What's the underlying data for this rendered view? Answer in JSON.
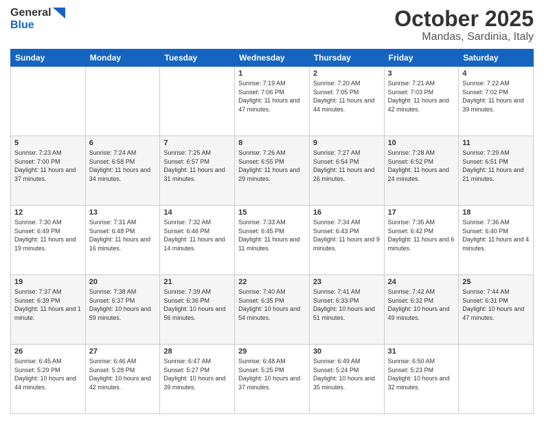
{
  "logo": {
    "line1": "General",
    "line2": "Blue"
  },
  "title": "October 2025",
  "location": "Mandas, Sardinia, Italy",
  "days_of_week": [
    "Sunday",
    "Monday",
    "Tuesday",
    "Wednesday",
    "Thursday",
    "Friday",
    "Saturday"
  ],
  "weeks": [
    [
      {
        "day": "",
        "text": ""
      },
      {
        "day": "",
        "text": ""
      },
      {
        "day": "",
        "text": ""
      },
      {
        "day": "1",
        "text": "Sunrise: 7:19 AM\nSunset: 7:06 PM\nDaylight: 11 hours and 47 minutes."
      },
      {
        "day": "2",
        "text": "Sunrise: 7:20 AM\nSunset: 7:05 PM\nDaylight: 11 hours and 44 minutes."
      },
      {
        "day": "3",
        "text": "Sunrise: 7:21 AM\nSunset: 7:03 PM\nDaylight: 11 hours and 42 minutes."
      },
      {
        "day": "4",
        "text": "Sunrise: 7:22 AM\nSunset: 7:02 PM\nDaylight: 11 hours and 39 minutes."
      }
    ],
    [
      {
        "day": "5",
        "text": "Sunrise: 7:23 AM\nSunset: 7:00 PM\nDaylight: 11 hours and 37 minutes."
      },
      {
        "day": "6",
        "text": "Sunrise: 7:24 AM\nSunset: 6:58 PM\nDaylight: 11 hours and 34 minutes."
      },
      {
        "day": "7",
        "text": "Sunrise: 7:25 AM\nSunset: 6:57 PM\nDaylight: 11 hours and 31 minutes."
      },
      {
        "day": "8",
        "text": "Sunrise: 7:26 AM\nSunset: 6:55 PM\nDaylight: 11 hours and 29 minutes."
      },
      {
        "day": "9",
        "text": "Sunrise: 7:27 AM\nSunset: 6:54 PM\nDaylight: 11 hours and 26 minutes."
      },
      {
        "day": "10",
        "text": "Sunrise: 7:28 AM\nSunset: 6:52 PM\nDaylight: 11 hours and 24 minutes."
      },
      {
        "day": "11",
        "text": "Sunrise: 7:29 AM\nSunset: 6:51 PM\nDaylight: 11 hours and 21 minutes."
      }
    ],
    [
      {
        "day": "12",
        "text": "Sunrise: 7:30 AM\nSunset: 6:49 PM\nDaylight: 11 hours and 19 minutes."
      },
      {
        "day": "13",
        "text": "Sunrise: 7:31 AM\nSunset: 6:48 PM\nDaylight: 11 hours and 16 minutes."
      },
      {
        "day": "14",
        "text": "Sunrise: 7:32 AM\nSunset: 6:46 PM\nDaylight: 11 hours and 14 minutes."
      },
      {
        "day": "15",
        "text": "Sunrise: 7:33 AM\nSunset: 6:45 PM\nDaylight: 11 hours and 11 minutes."
      },
      {
        "day": "16",
        "text": "Sunrise: 7:34 AM\nSunset: 6:43 PM\nDaylight: 11 hours and 9 minutes."
      },
      {
        "day": "17",
        "text": "Sunrise: 7:35 AM\nSunset: 6:42 PM\nDaylight: 11 hours and 6 minutes."
      },
      {
        "day": "18",
        "text": "Sunrise: 7:36 AM\nSunset: 6:40 PM\nDaylight: 11 hours and 4 minutes."
      }
    ],
    [
      {
        "day": "19",
        "text": "Sunrise: 7:37 AM\nSunset: 6:39 PM\nDaylight: 11 hours and 1 minute."
      },
      {
        "day": "20",
        "text": "Sunrise: 7:38 AM\nSunset: 6:37 PM\nDaylight: 10 hours and 59 minutes."
      },
      {
        "day": "21",
        "text": "Sunrise: 7:39 AM\nSunset: 6:36 PM\nDaylight: 10 hours and 56 minutes."
      },
      {
        "day": "22",
        "text": "Sunrise: 7:40 AM\nSunset: 6:35 PM\nDaylight: 10 hours and 54 minutes."
      },
      {
        "day": "23",
        "text": "Sunrise: 7:41 AM\nSunset: 6:33 PM\nDaylight: 10 hours and 51 minutes."
      },
      {
        "day": "24",
        "text": "Sunrise: 7:42 AM\nSunset: 6:32 PM\nDaylight: 10 hours and 49 minutes."
      },
      {
        "day": "25",
        "text": "Sunrise: 7:44 AM\nSunset: 6:31 PM\nDaylight: 10 hours and 47 minutes."
      }
    ],
    [
      {
        "day": "26",
        "text": "Sunrise: 6:45 AM\nSunset: 5:29 PM\nDaylight: 10 hours and 44 minutes."
      },
      {
        "day": "27",
        "text": "Sunrise: 6:46 AM\nSunset: 5:28 PM\nDaylight: 10 hours and 42 minutes."
      },
      {
        "day": "28",
        "text": "Sunrise: 6:47 AM\nSunset: 5:27 PM\nDaylight: 10 hours and 39 minutes."
      },
      {
        "day": "29",
        "text": "Sunrise: 6:48 AM\nSunset: 5:25 PM\nDaylight: 10 hours and 37 minutes."
      },
      {
        "day": "30",
        "text": "Sunrise: 6:49 AM\nSunset: 5:24 PM\nDaylight: 10 hours and 35 minutes."
      },
      {
        "day": "31",
        "text": "Sunrise: 6:50 AM\nSunset: 5:23 PM\nDaylight: 10 hours and 32 minutes."
      },
      {
        "day": "",
        "text": ""
      }
    ]
  ]
}
